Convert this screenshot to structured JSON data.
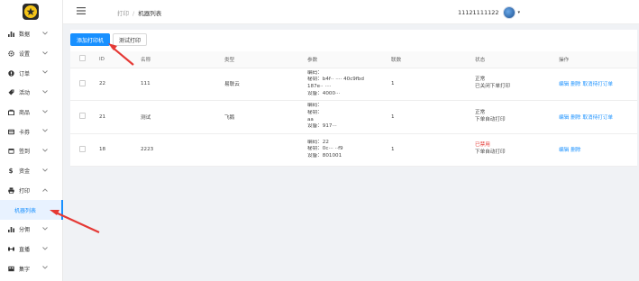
{
  "sidebar": {
    "items": [
      {
        "label": "数据",
        "icon": "bar-chart-icon",
        "expanded": false
      },
      {
        "label": "设置",
        "icon": "gear-icon",
        "expanded": false
      },
      {
        "label": "订单",
        "icon": "order-icon",
        "expanded": false
      },
      {
        "label": "活动",
        "icon": "tag-icon",
        "expanded": false
      },
      {
        "label": "商品",
        "icon": "bag-icon",
        "expanded": false
      },
      {
        "label": "卡券",
        "icon": "card-icon",
        "expanded": false
      },
      {
        "label": "签到",
        "icon": "calendar-icon",
        "expanded": false
      },
      {
        "label": "资金",
        "icon": "dollar-icon",
        "expanded": false
      },
      {
        "label": "打印",
        "icon": "printer-icon",
        "expanded": true
      },
      {
        "label": "机器列表",
        "sub": true,
        "active": true
      },
      {
        "label": "分佣",
        "icon": "bar-chart-icon",
        "expanded": false
      },
      {
        "label": "直播",
        "icon": "live-icon",
        "expanded": false
      },
      {
        "label": "集字",
        "icon": "grid-icon",
        "expanded": false
      }
    ]
  },
  "header": {
    "breadcrumb": [
      "打印",
      "机器列表"
    ],
    "account": "11121111122"
  },
  "toolbar": {
    "add_label": "添加打印机",
    "test_label": "测试打印"
  },
  "table": {
    "columns": [
      "ID",
      "名称",
      "类型",
      "参数",
      "联数",
      "状态",
      "操作"
    ],
    "rows": [
      {
        "id": "22",
        "name": "111",
        "type": "易联云",
        "params": [
          "编码：",
          "秘钥：b4f·· ···· 40c9fbd",
          "187e·· ····",
          "设备：4000···"
        ],
        "copies": "1",
        "status": "正常",
        "status_sub": "已关闭下单打印",
        "status_bad": false,
        "ops": [
          "编辑",
          "删除",
          "取消待打订单"
        ]
      },
      {
        "id": "21",
        "name": "测试",
        "type": "飞鹅",
        "params": [
          "编码：",
          "秘钥：",
          "aa",
          "设备：917···"
        ],
        "copies": "1",
        "status": "正常",
        "status_sub": "下单自动打印",
        "status_bad": false,
        "ops": [
          "编辑",
          "删除",
          "取消待打订单"
        ]
      },
      {
        "id": "18",
        "name": "2223",
        "type": "",
        "params": [
          "编码：22",
          "秘钥：0c··· ··f9",
          "设备：801001"
        ],
        "copies": "1",
        "status": "已禁用",
        "status_sub": "下单自动打印",
        "status_bad": true,
        "ops": [
          "编辑",
          "删除"
        ]
      }
    ]
  },
  "colors": {
    "accent": "#1890ff",
    "danger": "#e53935",
    "arrow": "#e53935"
  }
}
